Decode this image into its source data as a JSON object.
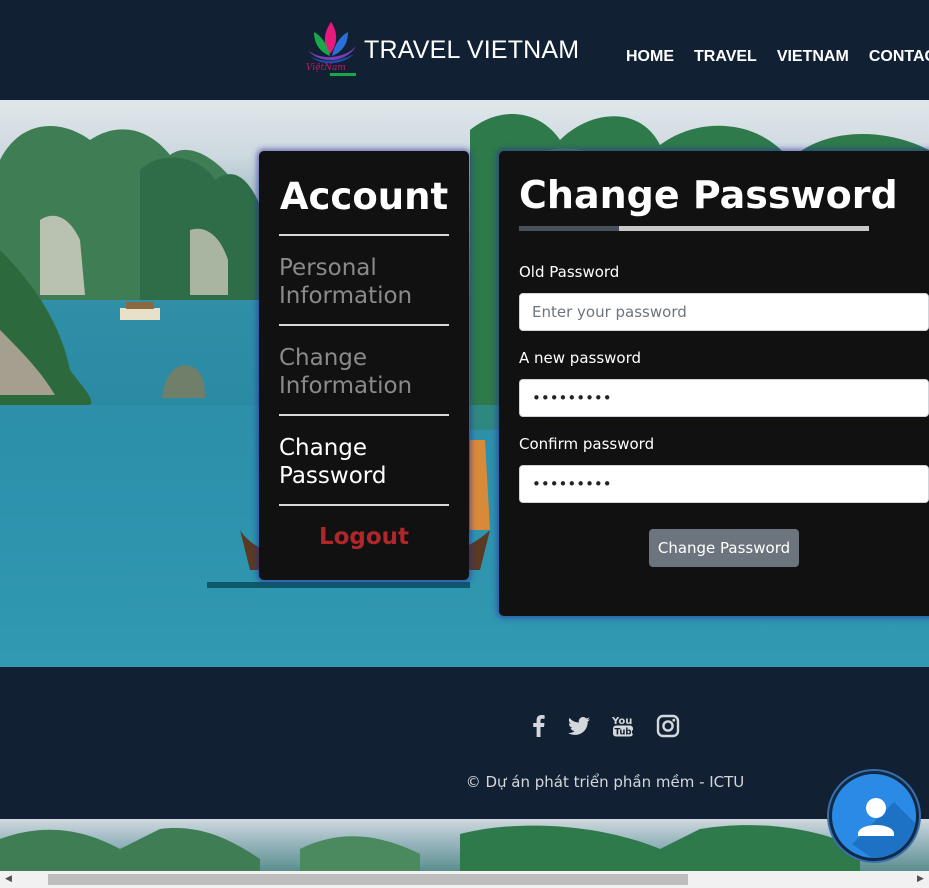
{
  "header": {
    "brand": "TRAVEL VIETNAM",
    "logo_icon": "vietnam-lotus-logo",
    "nav": [
      {
        "label": "HOME"
      },
      {
        "label": "TRAVEL"
      },
      {
        "label": "VIETNAM"
      },
      {
        "label": "CONTACT"
      }
    ]
  },
  "account": {
    "title": "Account",
    "items": [
      {
        "label": "Personal Information",
        "active": false
      },
      {
        "label": "Change Information",
        "active": false
      },
      {
        "label": "Change Password",
        "active": true
      }
    ],
    "logout": "Logout"
  },
  "change_password": {
    "title": "Change Password",
    "old_label": "Old Password",
    "old_placeholder": "Enter your password",
    "old_value": "",
    "new_label": "A new password",
    "new_value": "•••••••••",
    "confirm_label": "Confirm password",
    "confirm_value": "•••••••••",
    "submit": "Change Password"
  },
  "footer": {
    "social": [
      "facebook-icon",
      "twitter-icon",
      "youtube-icon",
      "instagram-icon"
    ],
    "copyright": "© Dự án phát triển phần mềm - ICTU"
  },
  "colors": {
    "header_bg": "#112033",
    "card_bg": "#111111",
    "logout": "#b0272b",
    "button": "#6c757d",
    "fab": "#2b8ae6"
  }
}
